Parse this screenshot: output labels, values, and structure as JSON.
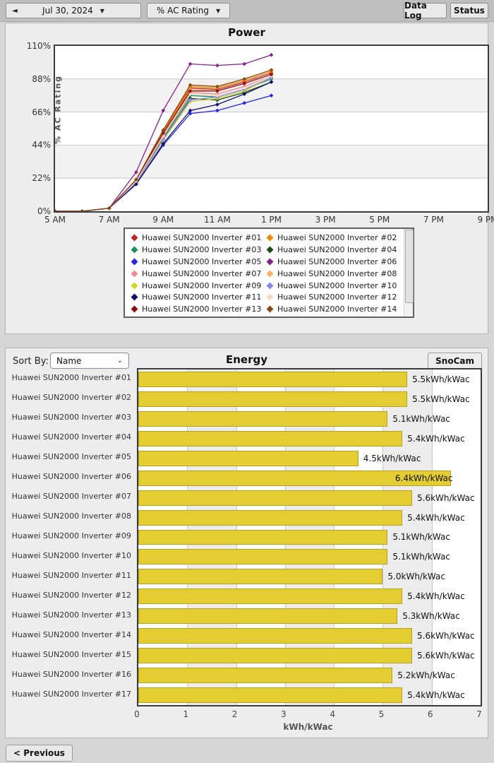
{
  "toolbar": {
    "prev_day_arrow": "◄",
    "date": "Jul 30, 2024",
    "date_caret": "▼",
    "metric": "% AC Rating",
    "metric_caret": "▼",
    "data_log": "Data Log",
    "status": "Status"
  },
  "power": {
    "title": "Power",
    "ylabel": "% AC Rating"
  },
  "energy": {
    "title": "Energy",
    "sort_by_label": "Sort By:",
    "sort_value": "Name",
    "sort_caret": "⌄",
    "snocam": "SnoCam",
    "xlabel": "kWh/kWac"
  },
  "footer": {
    "previous": "< Previous"
  },
  "chart_data": [
    {
      "type": "line",
      "title": "Power",
      "ylabel": "% AC Rating",
      "xlim": [
        5,
        21
      ],
      "ylim": [
        0,
        110
      ],
      "yticks": [
        0,
        22,
        44,
        66,
        88,
        110
      ],
      "ytick_labels": [
        "0%",
        "22%",
        "44%",
        "66%",
        "88%",
        "110%"
      ],
      "xticks": [
        5,
        7,
        9,
        11,
        13,
        15,
        17,
        19,
        21
      ],
      "xtick_labels": [
        "5 AM",
        "7 AM",
        "9 AM",
        "11 AM",
        "1 PM",
        "3 PM",
        "5 PM",
        "7 PM",
        "9 PM"
      ],
      "band_fill": "#f2f2f2",
      "grid": "horizontal",
      "x": [
        5,
        6,
        7,
        8,
        9,
        10,
        11,
        12,
        13
      ],
      "series": [
        {
          "name": "Huawei SUN2000 Inverter #01",
          "color": "#cc2020",
          "values": [
            0,
            0,
            2,
            21,
            53,
            82,
            81,
            86,
            92
          ]
        },
        {
          "name": "Huawei SUN2000 Inverter #02",
          "color": "#ee8800",
          "values": [
            0,
            0,
            2,
            21,
            53,
            83,
            82,
            87,
            93
          ]
        },
        {
          "name": "Huawei SUN2000 Inverter #03",
          "color": "#18915a",
          "values": [
            0,
            0,
            2,
            19,
            49,
            77,
            76,
            81,
            88
          ]
        },
        {
          "name": "Huawei SUN2000 Inverter #04",
          "color": "#1d4d12",
          "values": [
            0,
            0,
            2,
            19,
            48,
            75,
            74,
            79,
            86
          ]
        },
        {
          "name": "Huawei SUN2000 Inverter #05",
          "color": "#2525e8",
          "values": [
            0,
            0,
            2,
            18,
            44,
            65,
            67,
            72,
            77
          ]
        },
        {
          "name": "Huawei SUN2000 Inverter #06",
          "color": "#8a1f8f",
          "values": [
            0,
            0,
            2,
            26,
            67,
            98,
            97,
            98,
            104
          ]
        },
        {
          "name": "Huawei SUN2000 Inverter #07",
          "color": "#f08898",
          "values": [
            0,
            0,
            2,
            20,
            51,
            79,
            78,
            83,
            90
          ]
        },
        {
          "name": "Huawei SUN2000 Inverter #08",
          "color": "#f8b060",
          "values": [
            0,
            0,
            2,
            20,
            52,
            81,
            80,
            85,
            91
          ]
        },
        {
          "name": "Huawei SUN2000 Inverter #09",
          "color": "#d4d422",
          "values": [
            0,
            0,
            2,
            19,
            47,
            73,
            75,
            80,
            89
          ]
        },
        {
          "name": "Huawei SUN2000 Inverter #10",
          "color": "#8888ee",
          "values": [
            0,
            0,
            2,
            19,
            48,
            74,
            76,
            81,
            89
          ]
        },
        {
          "name": "Huawei SUN2000 Inverter #11",
          "color": "#10106a",
          "values": [
            0,
            0,
            2,
            18,
            45,
            67,
            71,
            78,
            86
          ]
        },
        {
          "name": "Huawei SUN2000 Inverter #12",
          "color": "#fcd8c0",
          "values": [
            0,
            0,
            2,
            20,
            50,
            78,
            77,
            82,
            90
          ]
        },
        {
          "name": "Huawei SUN2000 Inverter #13",
          "color": "#8f1010",
          "values": [
            0,
            0,
            2,
            21,
            52,
            80,
            80,
            85,
            91
          ]
        },
        {
          "name": "Huawei SUN2000 Inverter #14",
          "color": "#8a4a12",
          "values": [
            0,
            0,
            2,
            21,
            54,
            84,
            83,
            88,
            94
          ]
        }
      ],
      "legend_position": "below",
      "legend_scrollbar": true
    },
    {
      "type": "bar",
      "orientation": "horizontal",
      "title": "Energy",
      "xlabel": "kWh/kWac",
      "xlim": [
        0,
        7
      ],
      "xticks": [
        0,
        1,
        2,
        3,
        4,
        5,
        6,
        7
      ],
      "bar_color": "#e3cd31",
      "stripe_fill": "#ececec",
      "categories": [
        "Huawei SUN2000 Inverter #01",
        "Huawei SUN2000 Inverter #02",
        "Huawei SUN2000 Inverter #03",
        "Huawei SUN2000 Inverter #04",
        "Huawei SUN2000 Inverter #05",
        "Huawei SUN2000 Inverter #06",
        "Huawei SUN2000 Inverter #07",
        "Huawei SUN2000 Inverter #08",
        "Huawei SUN2000 Inverter #09",
        "Huawei SUN2000 Inverter #10",
        "Huawei SUN2000 Inverter #11",
        "Huawei SUN2000 Inverter #12",
        "Huawei SUN2000 Inverter #13",
        "Huawei SUN2000 Inverter #14",
        "Huawei SUN2000 Inverter #15",
        "Huawei SUN2000 Inverter #16",
        "Huawei SUN2000 Inverter #17"
      ],
      "values": [
        5.5,
        5.5,
        5.1,
        5.4,
        4.5,
        6.4,
        5.6,
        5.4,
        5.1,
        5.1,
        5.0,
        5.4,
        5.3,
        5.6,
        5.6,
        5.2,
        5.4
      ],
      "value_labels": [
        "5.5kWh/kWac",
        "5.5kWh/kWac",
        "5.1kWh/kWac",
        "5.4kWh/kWac",
        "4.5kWh/kWac",
        "6.4kWh/kWac",
        "5.6kWh/kWac",
        "5.4kWh/kWac",
        "5.1kWh/kWac",
        "5.1kWh/kWac",
        "5.0kWh/kWac",
        "5.4kWh/kWac",
        "5.3kWh/kWac",
        "5.6kWh/kWac",
        "5.6kWh/kWac",
        "5.2kWh/kWac",
        "5.4kWh/kWac"
      ]
    }
  ]
}
